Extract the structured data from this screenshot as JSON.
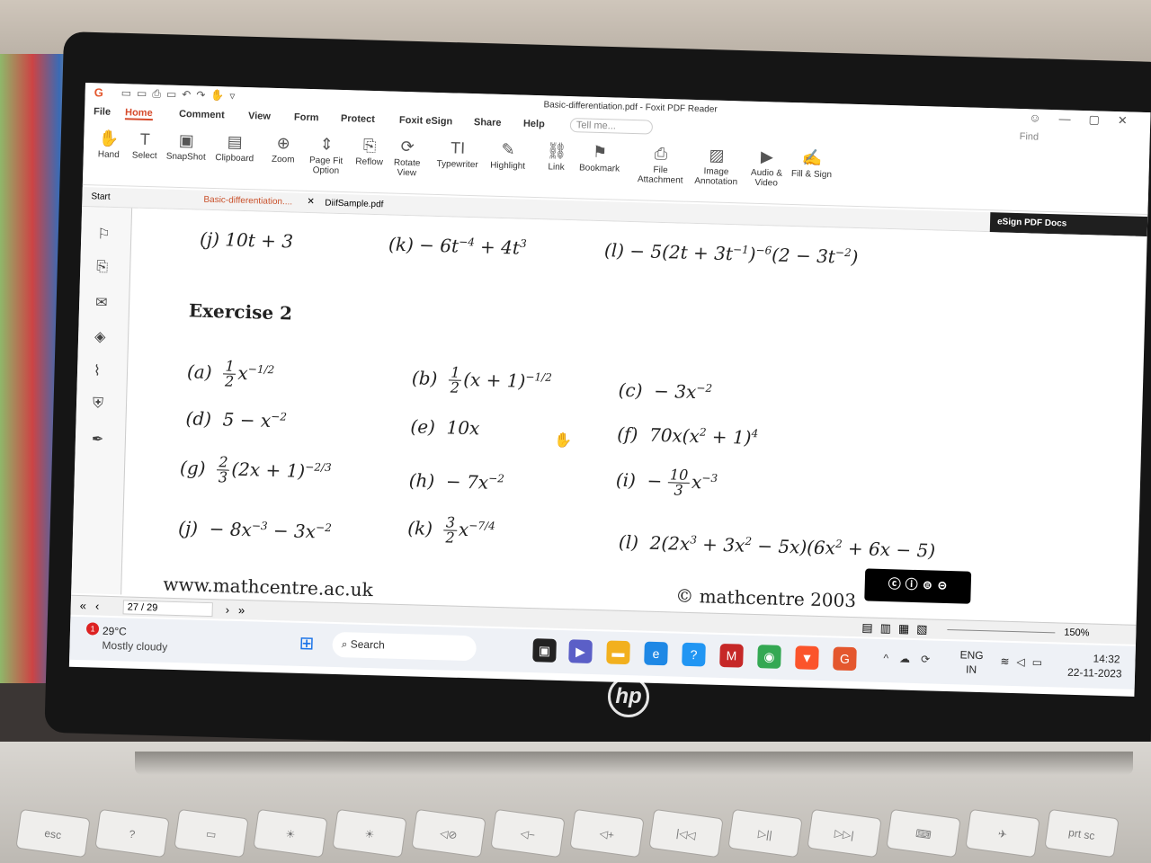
{
  "window": {
    "title": "Basic-differentiation.pdf - Foxit PDF Reader"
  },
  "menu": [
    "File",
    "Home",
    "Comment",
    "View",
    "Form",
    "Protect",
    "Foxit eSign",
    "Share",
    "Help"
  ],
  "tell_me": "Tell me...",
  "find": "Find",
  "ribbon": [
    "Hand",
    "Select",
    "SnapShot",
    "Clipboard",
    "Zoom",
    "Page Fit Option",
    "Reflow",
    "Rotate View",
    "Typewriter",
    "Highlight",
    "Link",
    "Bookmark",
    "File Attachment",
    "Image Annotation",
    "Audio & Video",
    "Fill & Sign"
  ],
  "tabs": {
    "start": "Start",
    "doc1": "Basic-differentiation....",
    "doc2": "DiifSample.pdf",
    "esign": "eSign PDF Docs"
  },
  "exercise_title": "Exercise 2",
  "row_prev": {
    "j": "(j)  10t + 3",
    "k": "(k)  − 6t",
    "l": "(l)  − 5(2t + 3t"
  },
  "answers": {
    "a": "(a)",
    "b": "(b)",
    "c": "(c)",
    "d": "(d)",
    "e": "(e)",
    "f": "(f)",
    "g": "(g)",
    "h": "(h)",
    "i": "(i)",
    "j": "(j)",
    "k": "(k)",
    "l": "(l)"
  },
  "footer": {
    "site": "www.mathcentre.ac.uk",
    "copyright": "© mathcentre 2003"
  },
  "status": {
    "page": "27 / 29",
    "zoom": "150%"
  },
  "taskbar": {
    "temp": "29°C",
    "weather": "Mostly cloudy",
    "search": "Search",
    "lang1": "ENG",
    "lang2": "IN",
    "time": "14:32",
    "date": "22-11-2023",
    "badge": "1"
  }
}
